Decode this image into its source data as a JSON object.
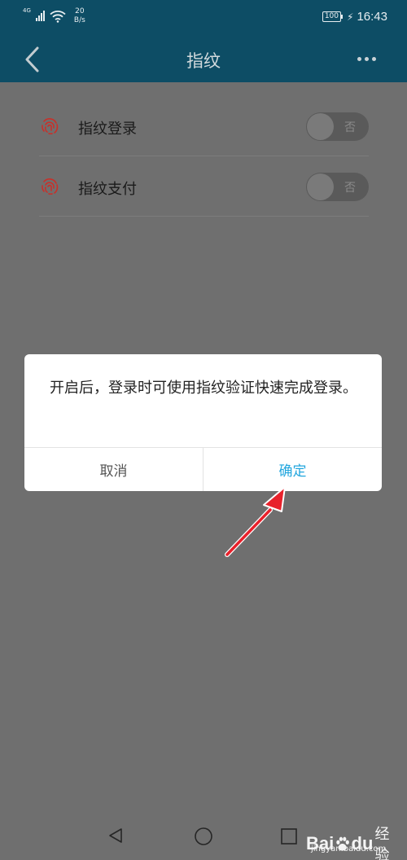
{
  "status_bar": {
    "network": "4G",
    "speed_value": "20",
    "speed_unit": "B/s",
    "battery": "100",
    "time": "16:43"
  },
  "app_bar": {
    "title": "指纹",
    "icons": [
      "back-icon",
      "more-icon"
    ]
  },
  "settings": [
    {
      "label": "指纹登录",
      "toggle_text": "否",
      "enabled": false,
      "icon": "fingerprint-icon"
    },
    {
      "label": "指纹支付",
      "toggle_text": "否",
      "enabled": false,
      "icon": "fingerprint-icon"
    }
  ],
  "dialog": {
    "message": "开启后，登录时可使用指纹验证快速完成登录。",
    "cancel_label": "取消",
    "confirm_label": "确定"
  },
  "nav_bar": {
    "icons": [
      "nav-back-icon",
      "nav-home-icon",
      "nav-recent-icon"
    ]
  },
  "watermark": {
    "brand_left": "Bai",
    "brand_right": "du",
    "brand_cn": "经验",
    "url": "jingyan.baidu.com"
  },
  "colors": {
    "app_bar": "#0d4d65",
    "overlay_background": "#6f6f6f",
    "confirm_accent": "#22a6de",
    "fingerprint": "#d9342b",
    "annotation_arrow": "#e8212b"
  }
}
